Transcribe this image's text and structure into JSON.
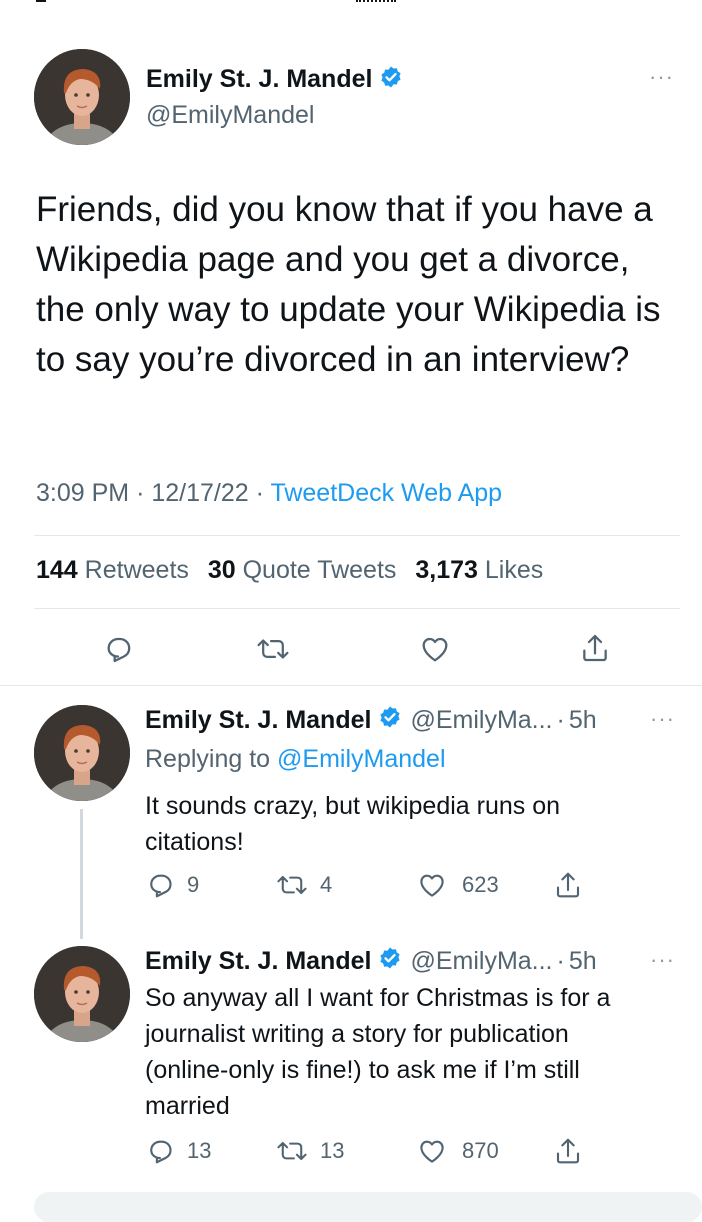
{
  "main_tweet": {
    "author_name": "Emily St. J. Mandel",
    "handle": "@EmilyMandel",
    "more_label": "···",
    "text": "Friends, did you know that if you have a Wikipedia page and you get a divorce, the only way to update your Wikipedia is to say you’re divorced in an interview?",
    "time": "3:09 PM",
    "date": "12/17/22",
    "separator": "·",
    "source": "TweetDeck Web App",
    "stats": {
      "retweets_count": "144",
      "retweets_label": "Retweets",
      "quotes_count": "30",
      "quotes_label": "Quote Tweets",
      "likes_count": "3,173",
      "likes_label": "Likes"
    }
  },
  "replies": [
    {
      "author_name": "Emily St. J. Mandel",
      "handle": "@EmilyMa...",
      "time_ago": "5h",
      "separator": "·",
      "more_label": "···",
      "replying_prefix": "Replying to",
      "replying_to": "@EmilyMandel",
      "text": "It sounds crazy, but wikipedia runs on citations!",
      "reply_count": "9",
      "retweet_count": "4",
      "like_count": "623"
    },
    {
      "author_name": "Emily St. J. Mandel",
      "handle": "@EmilyMa...",
      "time_ago": "5h",
      "separator": "·",
      "more_label": "···",
      "text": "So anyway all I want for Christmas is for a journalist writing a story for publication (online-only is fine!) to ask me if I’m still married",
      "reply_count": "13",
      "retweet_count": "13",
      "like_count": "870"
    }
  ],
  "icons": {
    "reply": "reply-icon",
    "retweet": "retweet-icon",
    "like": "heart-icon",
    "share": "share-icon",
    "verified": "verified-badge-icon",
    "more": "more-icon"
  },
  "colors": {
    "accent": "#1d9bf0",
    "secondary_text": "#536471",
    "divider": "#e3e8ec"
  }
}
